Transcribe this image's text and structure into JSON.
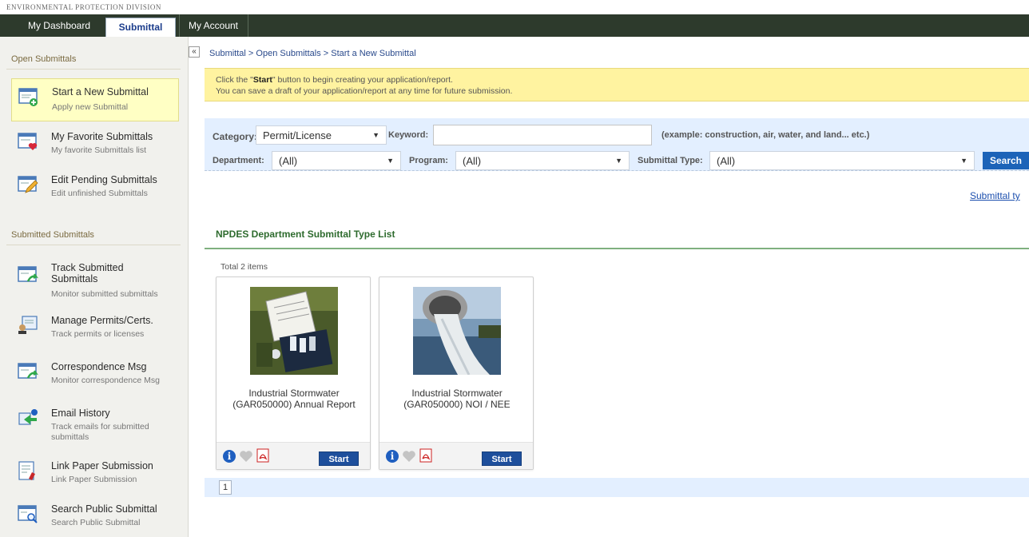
{
  "header": {
    "division": "ENVIRONMENTAL PROTECTION DIVISION"
  },
  "nav": {
    "tabs": [
      "My Dashboard",
      "Submittal",
      "My Account"
    ],
    "active": "Submittal"
  },
  "sidebar": {
    "open_heading": "Open Submittals",
    "submitted_heading": "Submitted Submittals",
    "items": [
      {
        "title": "Start a New Submittal",
        "sub": "Apply new Submittal",
        "icon": "add-form-icon"
      },
      {
        "title": "My Favorite Submittals",
        "sub": "My favorite Submittals list",
        "icon": "favorite-form-icon"
      },
      {
        "title": "Edit Pending Submittals",
        "sub": "Edit unfinished Submittals",
        "icon": "edit-form-icon"
      },
      {
        "title": "Track Submitted Submittals",
        "sub": "Monitor submitted submittals",
        "icon": "track-form-icon"
      },
      {
        "title": "Manage Permits/Certs.",
        "sub": "Track permits or licenses",
        "icon": "permit-icon"
      },
      {
        "title": "Correspondence Msg",
        "sub": "Monitor correspondence Msg",
        "icon": "correspondence-icon"
      },
      {
        "title": "Email History",
        "sub": "Track emails for submitted submittals",
        "icon": "email-history-icon"
      },
      {
        "title": "Link Paper Submission",
        "sub": "Link Paper Submission",
        "icon": "link-paper-icon"
      },
      {
        "title": "Search Public Submittal",
        "sub": "Search Public Submittal",
        "icon": "search-public-icon"
      }
    ]
  },
  "breadcrumb": {
    "items": [
      "Submittal",
      "Open Submittals",
      "Start a New Submittal"
    ],
    "separator": ">"
  },
  "notice": {
    "line1_pre": "Click the \"",
    "line1_bold": "Start",
    "line1_post": "\" button to begin creating your application/report.",
    "line2": "You can save a draft of your application/report at any time for future submission."
  },
  "filters": {
    "category_label": "Category:",
    "category_value": "Permit/License",
    "keyword_label": "Keyword:",
    "keyword_value": "",
    "keyword_hint": "(example: construction, air, water, and land... etc.)",
    "department_label": "Department:",
    "department_value": "(All)",
    "program_label": "Program:",
    "program_value": "(All)",
    "type_label": "Submittal Type:",
    "type_value": "(All)",
    "search_label": "Search"
  },
  "type_link": "Submittal ty",
  "list": {
    "title": "NPDES Department Submittal Type List",
    "total": "Total 2 items",
    "cards": [
      {
        "name": "Industrial Stormwater (GAR050000) Annual Report",
        "start": "Start"
      },
      {
        "name": "Industrial Stormwater (GAR050000) NOI / NEE",
        "start": "Start"
      }
    ]
  },
  "pager": {
    "page": "1"
  },
  "colors": {
    "nav_bg": "#2d3a2c",
    "accent_blue": "#1c63b8",
    "notice_bg": "#fff3a0",
    "filter_bg": "#e3efff",
    "list_title": "#2e6b2e"
  }
}
